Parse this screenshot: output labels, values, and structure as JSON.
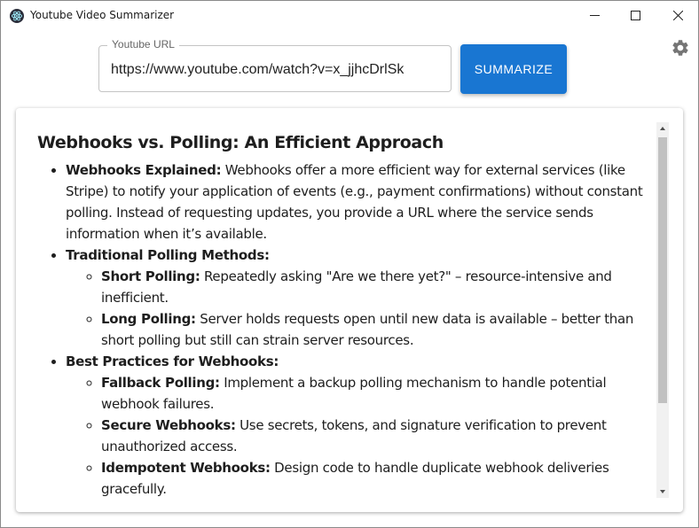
{
  "window": {
    "title": "Youtube Video Summarizer",
    "icon": "electron-atom-icon"
  },
  "form": {
    "url_label": "Youtube URL",
    "url_value": "https://www.youtube.com/watch?v=x_jjhcDrlSk",
    "summarize_label": "SUMMARIZE",
    "settings_icon": "gear-icon"
  },
  "summary": {
    "heading": "Webhooks vs. Polling: An Efficient Approach",
    "items": [
      {
        "label": "Webhooks Explained:",
        "text": " Webhooks offer a more efficient way for external services (like Stripe) to notify your application of events (e.g., payment confirmations) without constant polling. Instead of requesting updates, you provide a URL where the service sends information when it’s available."
      },
      {
        "label": "Traditional Polling Methods:",
        "children": [
          {
            "label": "Short Polling:",
            "text": " Repeatedly asking \"Are we there yet?\" – resource-intensive and inefficient."
          },
          {
            "label": "Long Polling:",
            "text": " Server holds requests open until new data is available – better than short polling but still can strain server resources."
          }
        ]
      },
      {
        "label": "Best Practices for Webhooks:",
        "children": [
          {
            "label": "Fallback Polling:",
            "text": " Implement a backup polling mechanism to handle potential webhook failures."
          },
          {
            "label": "Secure Webhooks:",
            "text": " Use secrets, tokens, and signature verification to prevent unauthorized access."
          },
          {
            "label": "Idempotent Webhooks:",
            "text": " Design code to handle duplicate webhook deliveries gracefully."
          }
        ]
      }
    ]
  },
  "colors": {
    "accent": "#1976d2",
    "scroll_thumb": "#c1c1c1"
  }
}
